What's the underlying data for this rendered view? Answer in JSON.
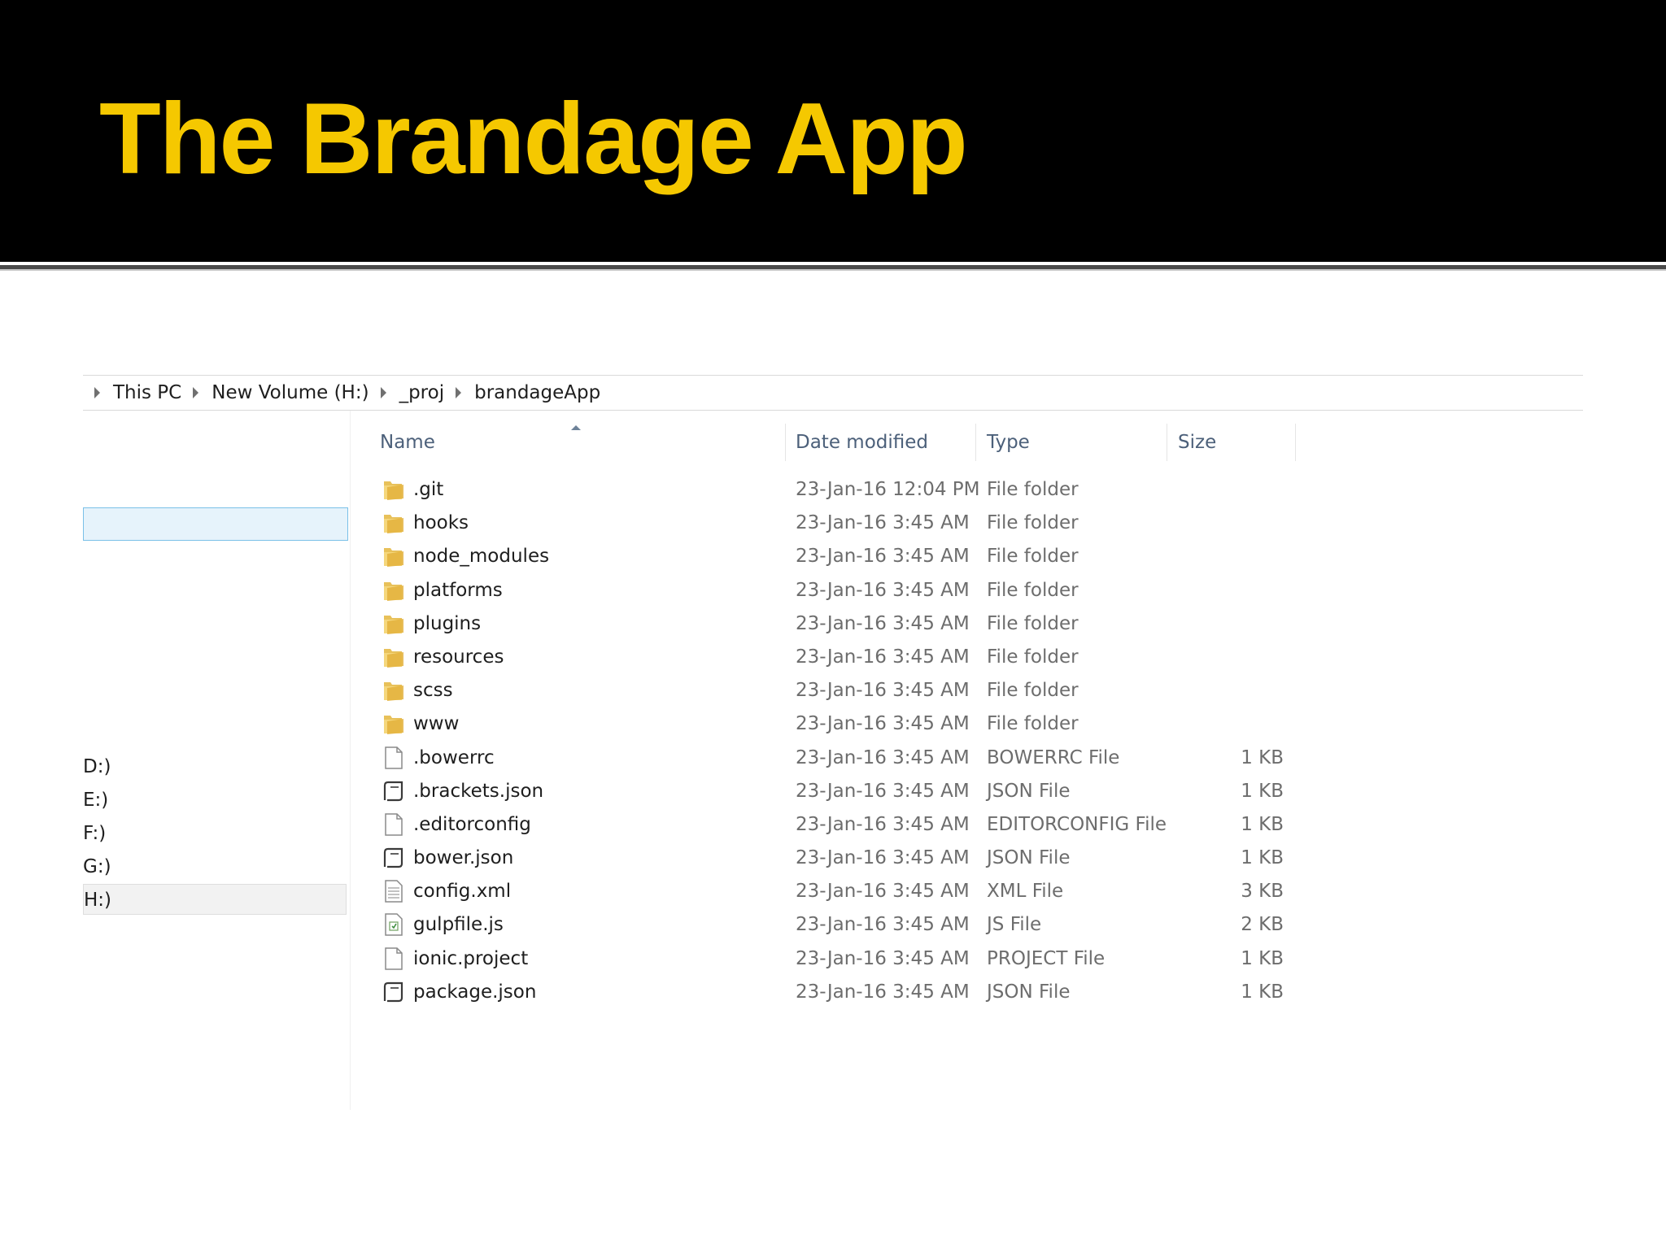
{
  "slide": {
    "title": "The Brandage App"
  },
  "breadcrumb": [
    "This PC",
    "New Volume (H:)",
    "_proj",
    "brandageApp"
  ],
  "nav_pane": {
    "drives": [
      "D:)",
      "E:)",
      "F:)",
      "G:)",
      "H:)"
    ]
  },
  "columns": {
    "name": "Name",
    "date": "Date modified",
    "type": "Type",
    "size": "Size"
  },
  "files": [
    {
      "name": ".git",
      "date": "23-Jan-16 12:04 PM",
      "type": "File folder",
      "size": "",
      "icon": "folder-icon"
    },
    {
      "name": "hooks",
      "date": "23-Jan-16 3:45 AM",
      "type": "File folder",
      "size": "",
      "icon": "folder-icon"
    },
    {
      "name": "node_modules",
      "date": "23-Jan-16 3:45 AM",
      "type": "File folder",
      "size": "",
      "icon": "folder-icon"
    },
    {
      "name": "platforms",
      "date": "23-Jan-16 3:45 AM",
      "type": "File folder",
      "size": "",
      "icon": "folder-icon"
    },
    {
      "name": "plugins",
      "date": "23-Jan-16 3:45 AM",
      "type": "File folder",
      "size": "",
      "icon": "folder-icon"
    },
    {
      "name": "resources",
      "date": "23-Jan-16 3:45 AM",
      "type": "File folder",
      "size": "",
      "icon": "folder-icon"
    },
    {
      "name": "scss",
      "date": "23-Jan-16 3:45 AM",
      "type": "File folder",
      "size": "",
      "icon": "folder-icon"
    },
    {
      "name": "www",
      "date": "23-Jan-16 3:45 AM",
      "type": "File folder",
      "size": "",
      "icon": "folder-icon"
    },
    {
      "name": ".bowerrc",
      "date": "23-Jan-16 3:45 AM",
      "type": "BOWERRC File",
      "size": "1 KB",
      "icon": "blank-file-icon"
    },
    {
      "name": ".brackets.json",
      "date": "23-Jan-16 3:45 AM",
      "type": "JSON File",
      "size": "1 KB",
      "icon": "json-file-icon"
    },
    {
      "name": ".editorconfig",
      "date": "23-Jan-16 3:45 AM",
      "type": "EDITORCONFIG File",
      "size": "1 KB",
      "icon": "blank-file-icon"
    },
    {
      "name": "bower.json",
      "date": "23-Jan-16 3:45 AM",
      "type": "JSON File",
      "size": "1 KB",
      "icon": "json-file-icon"
    },
    {
      "name": "config.xml",
      "date": "23-Jan-16 3:45 AM",
      "type": "XML File",
      "size": "3 KB",
      "icon": "text-file-icon"
    },
    {
      "name": "gulpfile.js",
      "date": "23-Jan-16 3:45 AM",
      "type": "JS File",
      "size": "2 KB",
      "icon": "script-file-icon"
    },
    {
      "name": "ionic.project",
      "date": "23-Jan-16 3:45 AM",
      "type": "PROJECT File",
      "size": "1 KB",
      "icon": "blank-file-icon"
    },
    {
      "name": "package.json",
      "date": "23-Jan-16 3:45 AM",
      "type": "JSON File",
      "size": "1 KB",
      "icon": "json-file-icon"
    }
  ]
}
